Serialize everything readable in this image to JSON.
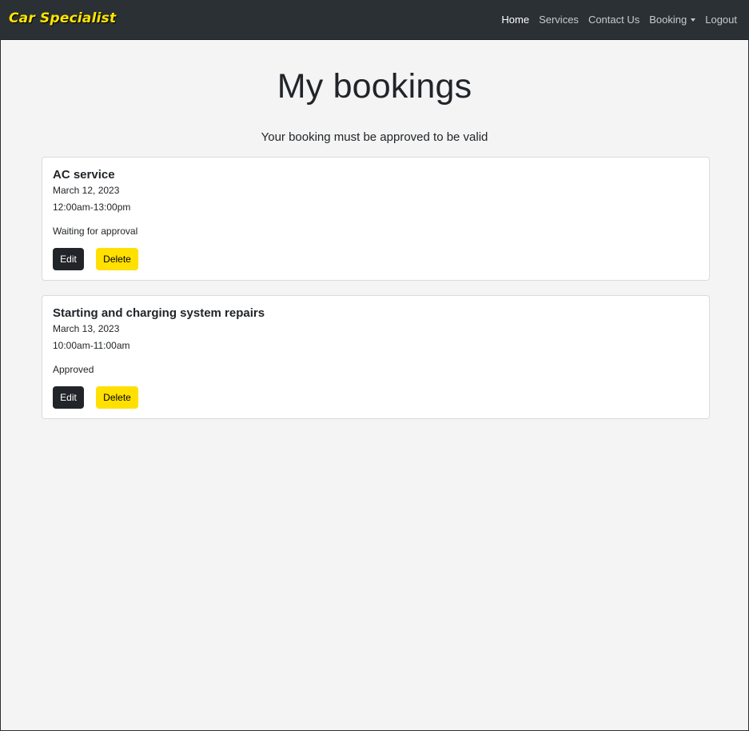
{
  "navbar": {
    "brand": "Car Specialist",
    "links": [
      {
        "label": "Home",
        "active": true
      },
      {
        "label": "Services",
        "active": false
      },
      {
        "label": "Contact Us",
        "active": false
      },
      {
        "label": "Booking",
        "active": false,
        "dropdown": true
      },
      {
        "label": "Logout",
        "active": false
      }
    ]
  },
  "page": {
    "title": "My bookings",
    "subtitle": "Your booking must be approved to be valid"
  },
  "bookings": [
    {
      "service": "AC service",
      "date": "March 12, 2023",
      "time": "12:00am-13:00pm",
      "status": "Waiting for approval",
      "edit_label": "Edit",
      "delete_label": "Delete"
    },
    {
      "service": "Starting and charging system repairs",
      "date": "March 13, 2023",
      "time": "10:00am-11:00am",
      "status": "Approved",
      "edit_label": "Edit",
      "delete_label": "Delete"
    }
  ],
  "colors": {
    "navbar_bg": "#2b3035",
    "brand": "#ffe600",
    "page_bg": "#f4f4f4",
    "edit_button": "#212529",
    "delete_button": "#ffe000"
  },
  "icons": {
    "booking_dropdown": "caret-down-icon"
  }
}
